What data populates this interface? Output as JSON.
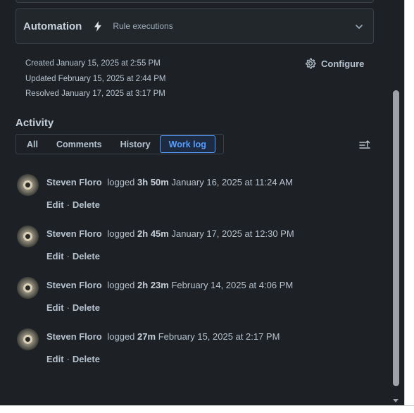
{
  "automation": {
    "title": "Automation",
    "subtitle": "Rule executions",
    "icon": "lightning-bolt-icon"
  },
  "dates": {
    "created": "Created January 15, 2025 at 2:55 PM",
    "updated": "Updated February 15, 2025 at 2:44 PM",
    "resolved": "Resolved January 17, 2025 at 3:17 PM"
  },
  "configure": {
    "label": "Configure",
    "icon": "gear-icon"
  },
  "activity": {
    "heading": "Activity",
    "tabs": [
      {
        "label": "All",
        "active": false
      },
      {
        "label": "Comments",
        "active": false
      },
      {
        "label": "History",
        "active": false
      },
      {
        "label": "Work log",
        "active": true
      }
    ],
    "sort_icon": "sort-icon"
  },
  "worklog": [
    {
      "author": "Steven Floro",
      "verb": "logged",
      "duration": "3h 50m",
      "timestamp": "January 16, 2025 at 11:24 AM",
      "edit": "Edit",
      "delete": "Delete"
    },
    {
      "author": "Steven Floro",
      "verb": "logged",
      "duration": "2h 45m",
      "timestamp": "January 17, 2025 at 12:30 PM",
      "edit": "Edit",
      "delete": "Delete"
    },
    {
      "author": "Steven Floro",
      "verb": "logged",
      "duration": "2h 23m",
      "timestamp": "February 14, 2025 at 4:06 PM",
      "edit": "Edit",
      "delete": "Delete"
    },
    {
      "author": "Steven Floro",
      "verb": "logged",
      "duration": "27m",
      "timestamp": "February 15, 2025 at 2:17 PM",
      "edit": "Edit",
      "delete": "Delete"
    }
  ],
  "colors": {
    "background": "#1d2125",
    "panel": "#22272b",
    "accent": "#579dff",
    "text": "#b6c2cf"
  }
}
